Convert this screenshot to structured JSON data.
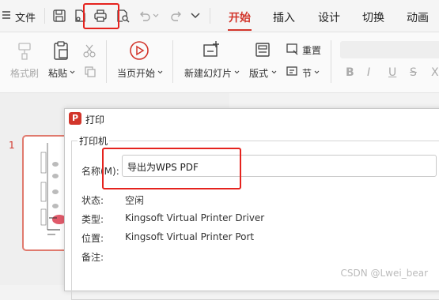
{
  "topbar": {
    "menu_icon": "hamburger-menu-icon",
    "file_label": "文件",
    "quick_icons": [
      "save-icon",
      "export-icon",
      "print-icon",
      "print-preview-icon",
      "undo-icon",
      "redo-icon",
      "chevron-down-icon"
    ],
    "tabs": [
      {
        "label": "开始",
        "active": true
      },
      {
        "label": "插入",
        "active": false
      },
      {
        "label": "设计",
        "active": false
      },
      {
        "label": "切换",
        "active": false
      },
      {
        "label": "动画",
        "active": false
      }
    ]
  },
  "ribbon": {
    "format_painter": "格式刷",
    "paste": "粘贴",
    "current_page_start": "当页开始",
    "new_slide": "新建幻灯片",
    "layout": "版式",
    "reset": "重置",
    "section": "节"
  },
  "slides_panel": {
    "slide_number": "1"
  },
  "print_dialog": {
    "title": "打印",
    "app_icon_letter": "P",
    "group_label": "打印机",
    "name_label": "名称(M):",
    "name_value": "导出为WPS PDF",
    "status_label": "状态:",
    "status_value": "空闲",
    "type_label": "类型:",
    "type_value": "Kingsoft Virtual Printer Driver",
    "location_label": "位置:",
    "location_value": "Kingsoft Virtual Printer Port",
    "comment_label": "备注:"
  },
  "watermark": "CSDN @Lwei_bear",
  "colors": {
    "accent": "#d2352b",
    "highlight_box": "#e5231e"
  }
}
